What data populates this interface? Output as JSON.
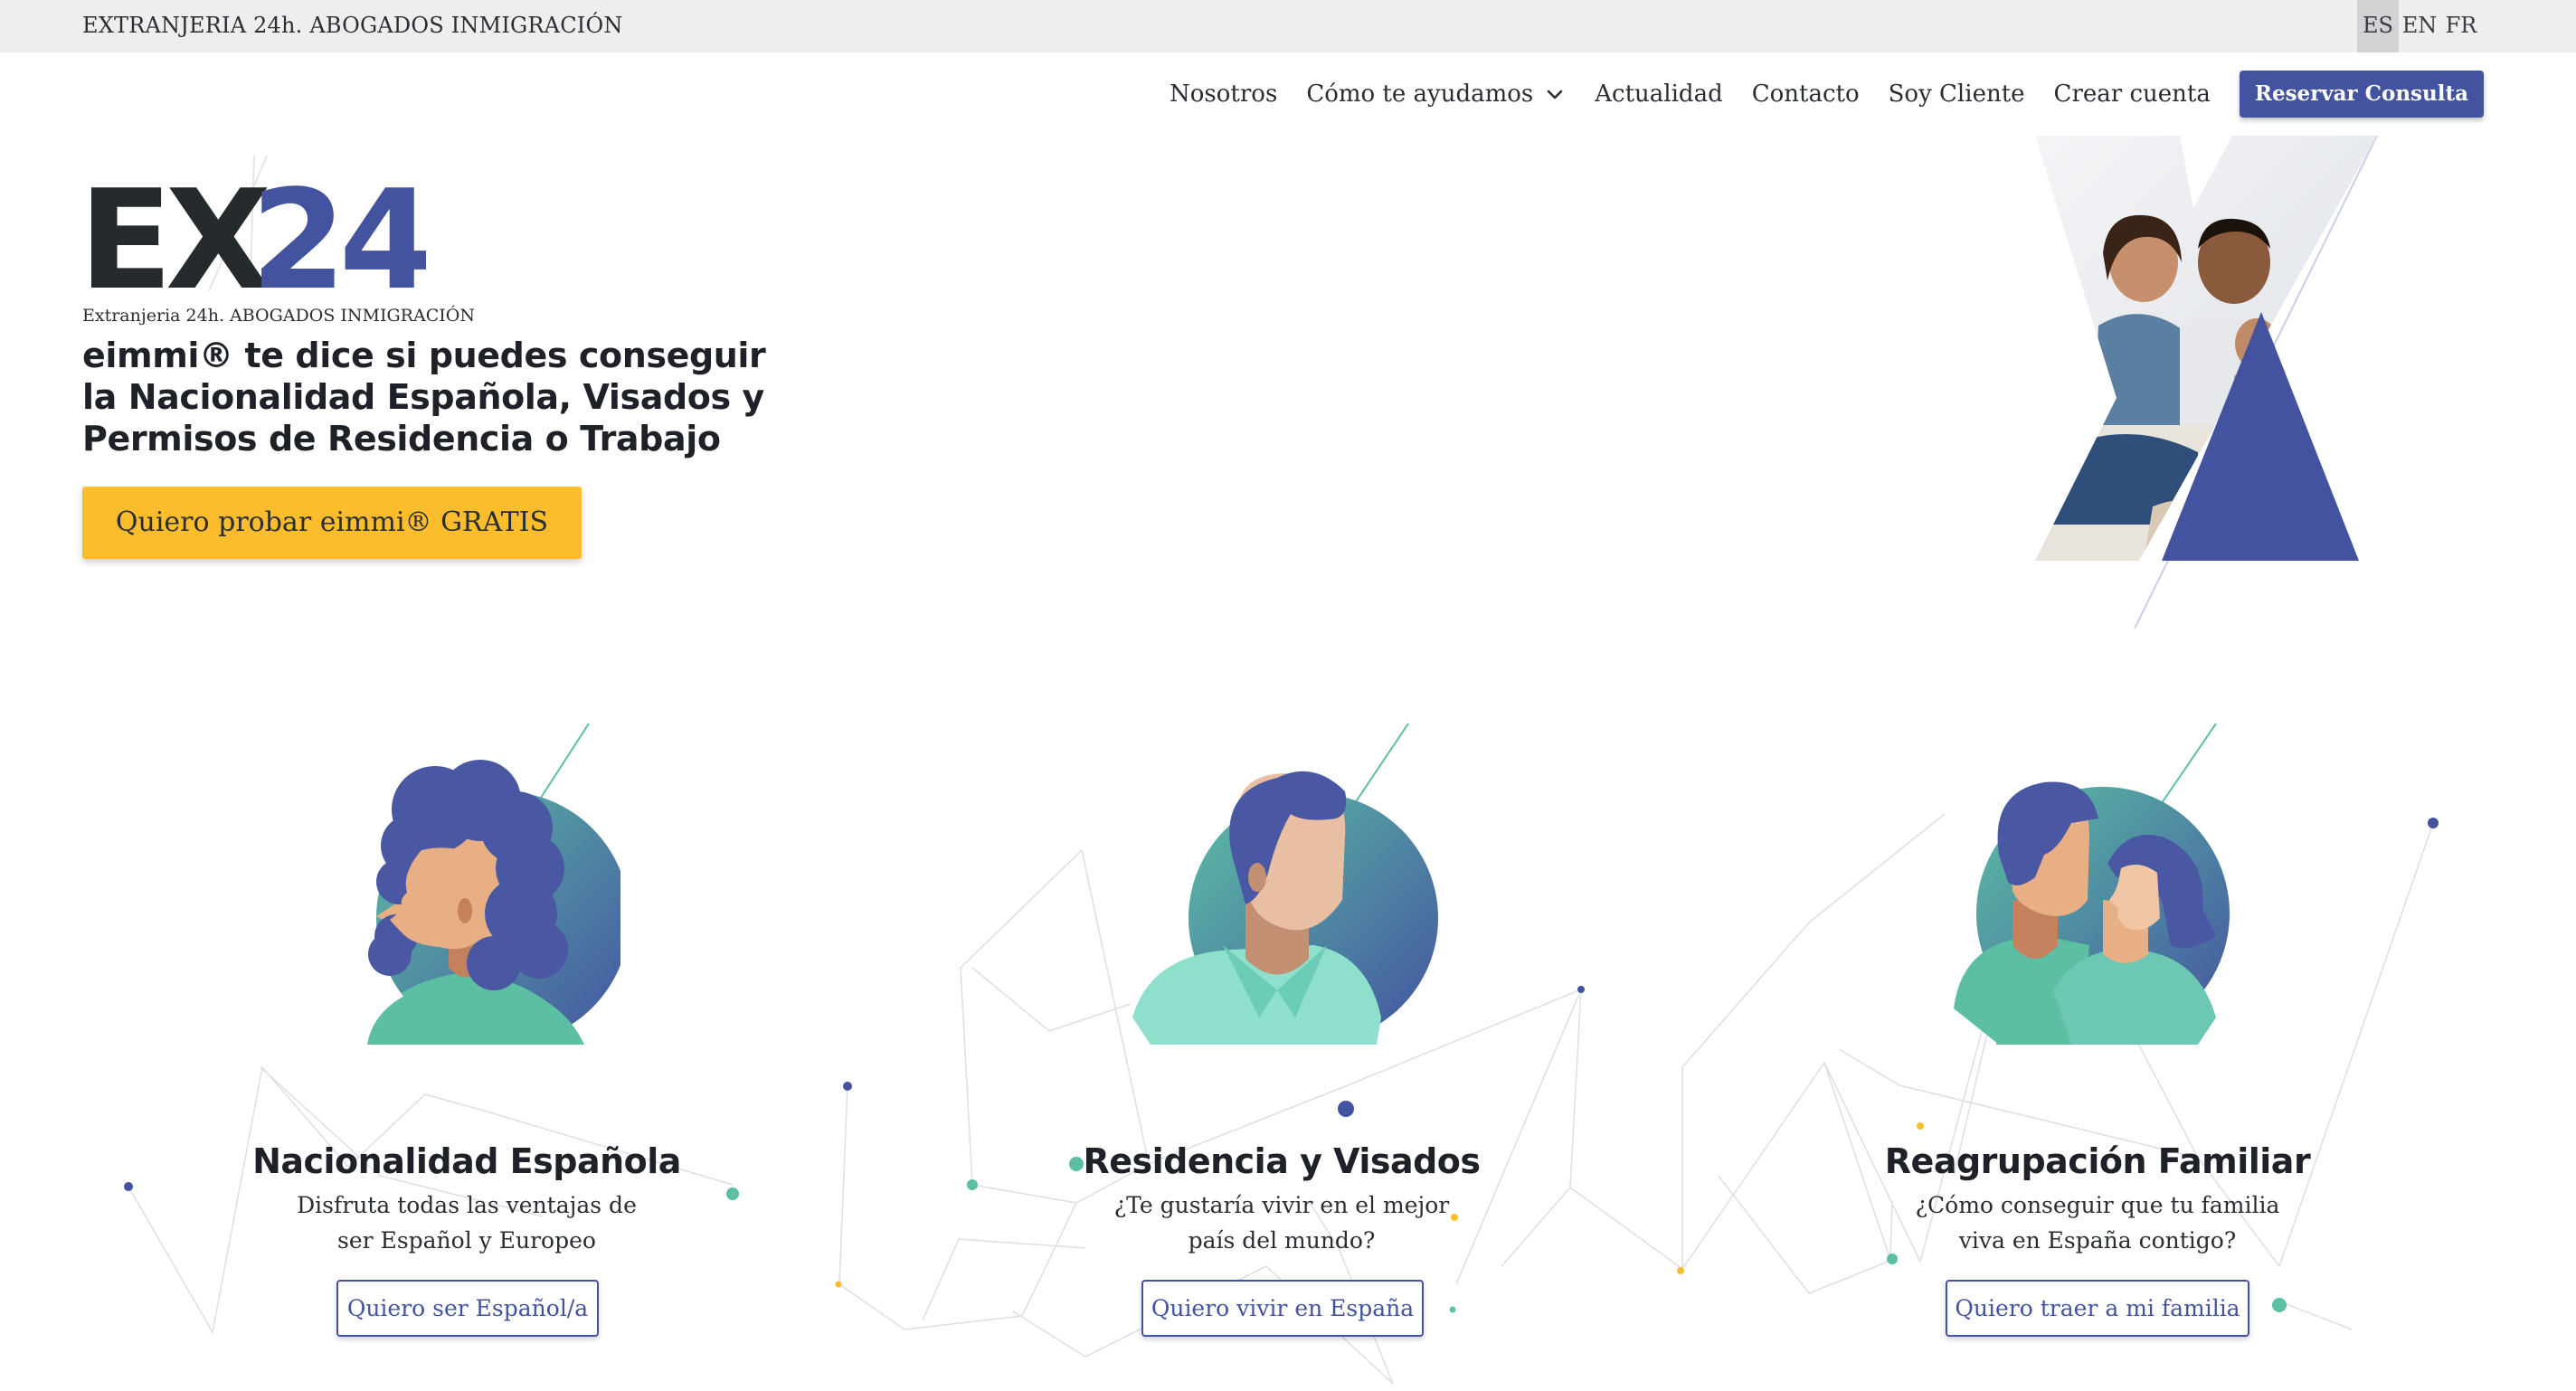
{
  "topbar": {
    "brand": "EXTRANJERIA 24h. ABOGADOS INMIGRACIÓN",
    "languages": [
      {
        "code": "ES",
        "active": true
      },
      {
        "code": "EN",
        "active": false
      },
      {
        "code": "FR",
        "active": false
      }
    ]
  },
  "nav": {
    "items": [
      "Nosotros",
      "Cómo te ayudamos",
      "Actualidad",
      "Contacto",
      "Soy Cliente",
      "Crear cuenta"
    ],
    "cta": "Reservar Consulta"
  },
  "hero": {
    "logo_letters": "EX",
    "logo_number": "24",
    "logo_subtitle": "Extranjeria 24h. ABOGADOS INMIGRACIÓN",
    "title": "eimmi® te dice si puedes conseguir la Nacionalidad Española, Visados y Permisos de Residencia o Trabajo",
    "button": "Quiero probar eimmi® GRATIS"
  },
  "services": [
    {
      "title": "Nacionalidad Española",
      "description": "Disfruta todas las ventajas de ser Español y Europeo",
      "button": "Quiero ser Español/a"
    },
    {
      "title": "Residencia y Visados",
      "description": "¿Te gustaría vivir en el mejor país del mundo?",
      "button": "Quiero vivir en España"
    },
    {
      "title": "Reagrupación Familiar",
      "description": "¿Cómo conseguir que tu familia viva en España contigo?",
      "button": "Quiero traer a mi familia"
    }
  ],
  "colors": {
    "brand_blue": "#4353a0",
    "accent_yellow": "#fbbd2b",
    "teal": "#5cbfa4",
    "dark": "#1e2127"
  }
}
